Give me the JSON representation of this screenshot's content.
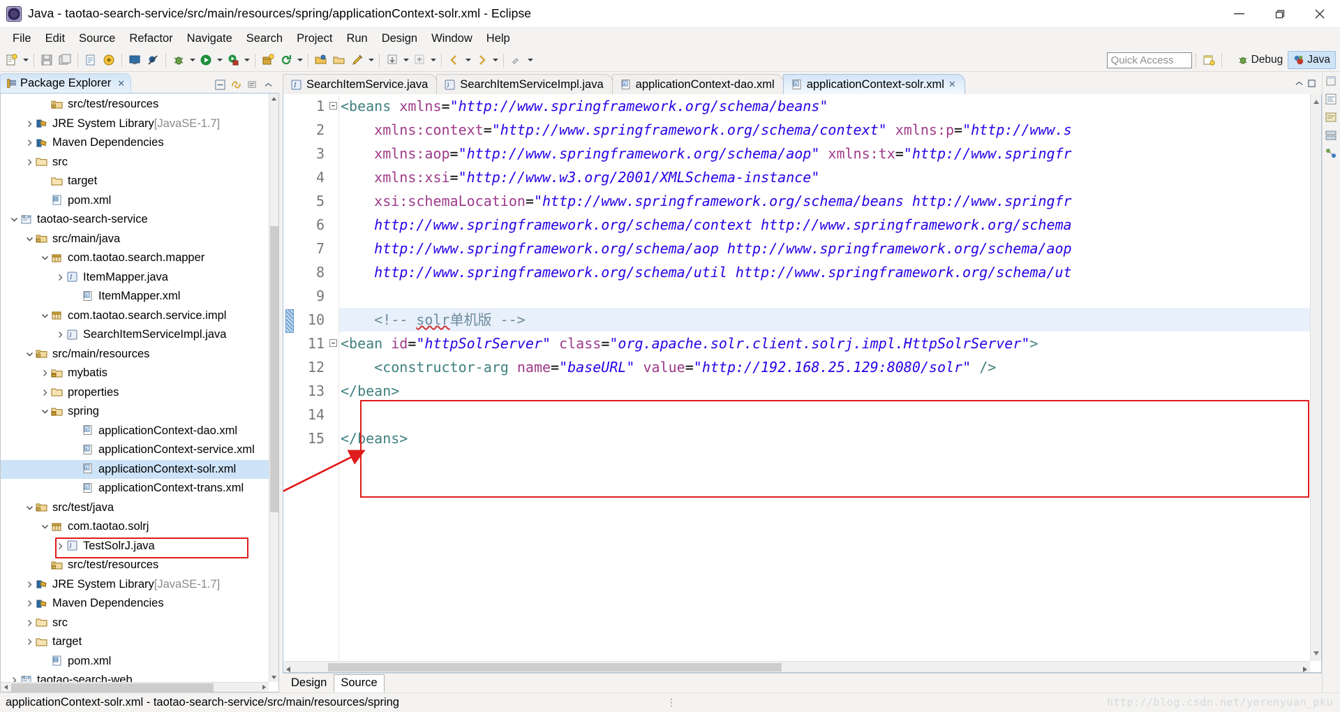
{
  "window": {
    "title": "Java - taotao-search-service/src/main/resources/spring/applicationContext-solr.xml - Eclipse",
    "minimize_label": "Minimize",
    "restore_label": "Restore",
    "close_label": "Close"
  },
  "menubar": {
    "items": [
      "File",
      "Edit",
      "Source",
      "Refactor",
      "Navigate",
      "Search",
      "Project",
      "Run",
      "Design",
      "Window",
      "Help"
    ]
  },
  "toolbar": {
    "quick_access_placeholder": "Quick Access",
    "perspectives": [
      {
        "label": "Debug",
        "active": false
      },
      {
        "label": "Java",
        "active": true
      }
    ],
    "open_perspective_tooltip": "Open Perspective"
  },
  "package_explorer": {
    "tab_label": "Package Explorer",
    "close_glyph": "✕",
    "tree": [
      {
        "indent": 2,
        "arrow": "none",
        "icon": "source-folder-icon",
        "label": "src/test/resources",
        "suffix": "",
        "selected": false
      },
      {
        "indent": 1,
        "arrow": "right",
        "icon": "library-icon",
        "label": "JRE System Library",
        "suffix": " [JavaSE-1.7]",
        "selected": false
      },
      {
        "indent": 1,
        "arrow": "right",
        "icon": "library-icon",
        "label": "Maven Dependencies",
        "suffix": "",
        "selected": false
      },
      {
        "indent": 1,
        "arrow": "right",
        "icon": "folder-icon",
        "label": "src",
        "suffix": "",
        "selected": false
      },
      {
        "indent": 2,
        "arrow": "none",
        "icon": "folder-icon",
        "label": "target",
        "suffix": "",
        "selected": false
      },
      {
        "indent": 2,
        "arrow": "none",
        "icon": "maven-pom-icon",
        "label": "pom.xml",
        "suffix": "",
        "selected": false
      },
      {
        "indent": 0,
        "arrow": "down",
        "icon": "maven-project-icon",
        "label": "taotao-search-service",
        "suffix": "",
        "selected": false
      },
      {
        "indent": 1,
        "arrow": "down",
        "icon": "source-folder-icon",
        "label": "src/main/java",
        "suffix": "",
        "selected": false
      },
      {
        "indent": 2,
        "arrow": "down",
        "icon": "package-icon",
        "label": "com.taotao.search.mapper",
        "suffix": "",
        "selected": false
      },
      {
        "indent": 3,
        "arrow": "right",
        "icon": "interface-icon",
        "label": "ItemMapper.java",
        "suffix": "",
        "selected": false
      },
      {
        "indent": 4,
        "arrow": "none",
        "icon": "xml-file-icon",
        "label": "ItemMapper.xml",
        "suffix": "",
        "selected": false
      },
      {
        "indent": 2,
        "arrow": "down",
        "icon": "package-icon",
        "label": "com.taotao.search.service.impl",
        "suffix": "",
        "selected": false
      },
      {
        "indent": 3,
        "arrow": "right",
        "icon": "class-icon",
        "label": "SearchItemServiceImpl.java",
        "suffix": "",
        "selected": false
      },
      {
        "indent": 1,
        "arrow": "down",
        "icon": "source-folder-icon",
        "label": "src/main/resources",
        "suffix": "",
        "selected": false
      },
      {
        "indent": 2,
        "arrow": "right",
        "icon": "package-folder-icon",
        "label": "mybatis",
        "suffix": "",
        "selected": false
      },
      {
        "indent": 2,
        "arrow": "right",
        "icon": "folder-icon",
        "label": "properties",
        "suffix": "",
        "selected": false
      },
      {
        "indent": 2,
        "arrow": "down",
        "icon": "package-folder-icon",
        "label": "spring",
        "suffix": "",
        "selected": false
      },
      {
        "indent": 4,
        "arrow": "none",
        "icon": "xml-file-icon",
        "label": "applicationContext-dao.xml",
        "suffix": "",
        "selected": false
      },
      {
        "indent": 4,
        "arrow": "none",
        "icon": "xml-file-icon",
        "label": "applicationContext-service.xml",
        "suffix": "",
        "selected": false
      },
      {
        "indent": 4,
        "arrow": "none",
        "icon": "xml-file-icon",
        "label": "applicationContext-solr.xml",
        "suffix": "",
        "selected": true
      },
      {
        "indent": 4,
        "arrow": "none",
        "icon": "xml-file-icon",
        "label": "applicationContext-trans.xml",
        "suffix": "",
        "selected": false
      },
      {
        "indent": 1,
        "arrow": "down",
        "icon": "source-folder-icon",
        "label": "src/test/java",
        "suffix": "",
        "selected": false
      },
      {
        "indent": 2,
        "arrow": "down",
        "icon": "package-icon",
        "label": "com.taotao.solrj",
        "suffix": "",
        "selected": false
      },
      {
        "indent": 3,
        "arrow": "right",
        "icon": "class-icon",
        "label": "TestSolrJ.java",
        "suffix": "",
        "selected": false
      },
      {
        "indent": 2,
        "arrow": "none",
        "icon": "source-folder-icon",
        "label": "src/test/resources",
        "suffix": "",
        "selected": false
      },
      {
        "indent": 1,
        "arrow": "right",
        "icon": "library-icon",
        "label": "JRE System Library",
        "suffix": " [JavaSE-1.7]",
        "selected": false
      },
      {
        "indent": 1,
        "arrow": "right",
        "icon": "library-icon",
        "label": "Maven Dependencies",
        "suffix": "",
        "selected": false
      },
      {
        "indent": 1,
        "arrow": "right",
        "icon": "folder-icon",
        "label": "src",
        "suffix": "",
        "selected": false
      },
      {
        "indent": 1,
        "arrow": "right",
        "icon": "folder-icon",
        "label": "target",
        "suffix": "",
        "selected": false
      },
      {
        "indent": 2,
        "arrow": "none",
        "icon": "maven-pom-icon",
        "label": "pom.xml",
        "suffix": "",
        "selected": false
      },
      {
        "indent": 0,
        "arrow": "right",
        "icon": "maven-project-icon",
        "label": "taotao-search-web",
        "suffix": "",
        "selected": false
      }
    ]
  },
  "editor": {
    "tabs": [
      {
        "label": "SearchItemService.java",
        "icon": "interface-icon",
        "active": false,
        "close_glyph": ""
      },
      {
        "label": "SearchItemServiceImpl.java",
        "icon": "class-icon",
        "active": false,
        "close_glyph": ""
      },
      {
        "label": "applicationContext-dao.xml",
        "icon": "xml-file-icon",
        "active": false,
        "close_glyph": ""
      },
      {
        "label": "applicationContext-solr.xml",
        "icon": "xml-file-icon",
        "active": true,
        "close_glyph": "✕"
      }
    ],
    "bottom_tabs": [
      {
        "label": "Design",
        "active": false
      },
      {
        "label": "Source",
        "active": true
      }
    ],
    "lines": [
      {
        "n": "1",
        "fold": "minus",
        "highlight": false,
        "tokens": [
          {
            "t": "tag",
            "v": "<beans "
          },
          {
            "t": "att",
            "v": "xmlns"
          },
          {
            "t": "eq",
            "v": "="
          },
          {
            "t": "val",
            "v": "\"http://www.springframework.org/schema/beans\""
          }
        ]
      },
      {
        "n": "2",
        "fold": "",
        "highlight": false,
        "tokens": [
          {
            "t": "plain",
            "v": "    "
          },
          {
            "t": "att",
            "v": "xmlns:context"
          },
          {
            "t": "eq",
            "v": "="
          },
          {
            "t": "val",
            "v": "\"http://www.springframework.org/schema/context\""
          },
          {
            "t": "plain",
            "v": " "
          },
          {
            "t": "att",
            "v": "xmlns:p"
          },
          {
            "t": "eq",
            "v": "="
          },
          {
            "t": "val",
            "v": "\"http://www.s"
          }
        ]
      },
      {
        "n": "3",
        "fold": "",
        "highlight": false,
        "tokens": [
          {
            "t": "plain",
            "v": "    "
          },
          {
            "t": "att",
            "v": "xmlns:aop"
          },
          {
            "t": "eq",
            "v": "="
          },
          {
            "t": "val",
            "v": "\"http://www.springframework.org/schema/aop\""
          },
          {
            "t": "plain",
            "v": " "
          },
          {
            "t": "att",
            "v": "xmlns:tx"
          },
          {
            "t": "eq",
            "v": "="
          },
          {
            "t": "val",
            "v": "\"http://www.springfr"
          }
        ]
      },
      {
        "n": "4",
        "fold": "",
        "highlight": false,
        "tokens": [
          {
            "t": "plain",
            "v": "    "
          },
          {
            "t": "att",
            "v": "xmlns:xsi"
          },
          {
            "t": "eq",
            "v": "="
          },
          {
            "t": "val",
            "v": "\"http://www.w3.org/2001/XMLSchema-instance\""
          }
        ]
      },
      {
        "n": "5",
        "fold": "",
        "highlight": false,
        "tokens": [
          {
            "t": "plain",
            "v": "    "
          },
          {
            "t": "att",
            "v": "xsi:schemaLocation"
          },
          {
            "t": "eq",
            "v": "="
          },
          {
            "t": "val",
            "v": "\"http://www.springframework.org/schema/beans http://www.springfr"
          }
        ]
      },
      {
        "n": "6",
        "fold": "",
        "highlight": false,
        "tokens": [
          {
            "t": "plain",
            "v": "    "
          },
          {
            "t": "val",
            "v": "http://www.springframework.org/schema/context http://www.springframework.org/schema"
          }
        ]
      },
      {
        "n": "7",
        "fold": "",
        "highlight": false,
        "tokens": [
          {
            "t": "plain",
            "v": "    "
          },
          {
            "t": "val",
            "v": "http://www.springframework.org/schema/aop http://www.springframework.org/schema/aop"
          }
        ]
      },
      {
        "n": "8",
        "fold": "",
        "highlight": false,
        "tokens": [
          {
            "t": "plain",
            "v": "    "
          },
          {
            "t": "val",
            "v": "http://www.springframework.org/schema/util http://www.springframework.org/schema/ut"
          }
        ]
      },
      {
        "n": "9",
        "fold": "",
        "highlight": false,
        "tokens": []
      },
      {
        "n": "10",
        "fold": "",
        "highlight": true,
        "tokens": [
          {
            "t": "plain",
            "v": "    "
          },
          {
            "t": "cmt",
            "v": "<!-- "
          },
          {
            "t": "cmt-squig",
            "v": "solr"
          },
          {
            "t": "cmt-cn",
            "v": "单机版"
          },
          {
            "t": "cmt",
            "v": " -->"
          }
        ]
      },
      {
        "n": "11",
        "fold": "minus",
        "highlight": false,
        "tokens": [
          {
            "t": "tag",
            "v": "<bean "
          },
          {
            "t": "att",
            "v": "id"
          },
          {
            "t": "eq",
            "v": "="
          },
          {
            "t": "val",
            "v": "\"httpSolrServer\""
          },
          {
            "t": "plain",
            "v": " "
          },
          {
            "t": "att",
            "v": "class"
          },
          {
            "t": "eq",
            "v": "="
          },
          {
            "t": "val",
            "v": "\"org.apache.solr.client.solrj.impl.HttpSolrServer\""
          },
          {
            "t": "tag",
            "v": ">"
          }
        ]
      },
      {
        "n": "12",
        "fold": "",
        "highlight": false,
        "tokens": [
          {
            "t": "plain",
            "v": "    "
          },
          {
            "t": "tag",
            "v": "<constructor-arg "
          },
          {
            "t": "att",
            "v": "name"
          },
          {
            "t": "eq",
            "v": "="
          },
          {
            "t": "val",
            "v": "\"baseURL\""
          },
          {
            "t": "plain",
            "v": " "
          },
          {
            "t": "att",
            "v": "value"
          },
          {
            "t": "eq",
            "v": "="
          },
          {
            "t": "val",
            "v": "\"http://192.168.25.129:8080/solr\""
          },
          {
            "t": "plain",
            "v": " "
          },
          {
            "t": "tag",
            "v": "/>"
          }
        ]
      },
      {
        "n": "13",
        "fold": "",
        "highlight": false,
        "tokens": [
          {
            "t": "tag",
            "v": "</bean>"
          }
        ]
      },
      {
        "n": "14",
        "fold": "",
        "highlight": false,
        "tokens": []
      },
      {
        "n": "15",
        "fold": "",
        "highlight": false,
        "tokens": [
          {
            "t": "tag",
            "v": "</beans>"
          }
        ]
      }
    ]
  },
  "statusbar": {
    "text": "applicationContext-solr.xml - taotao-search-service/src/main/resources/spring",
    "watermark": "http://blog.csdn.net/yerenyuan_pku"
  }
}
